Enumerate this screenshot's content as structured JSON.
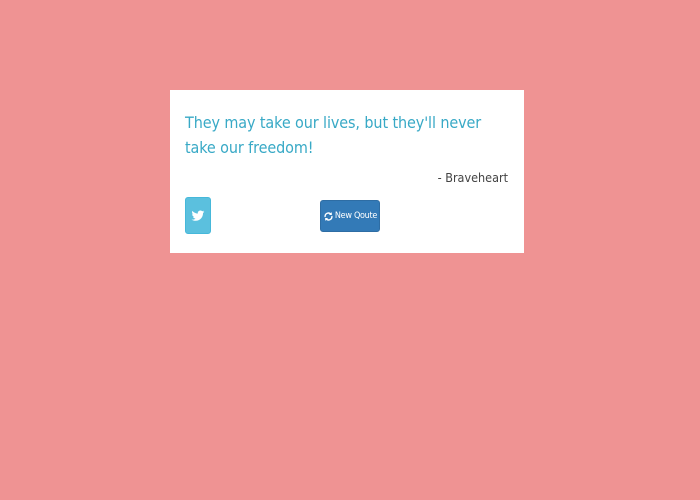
{
  "quote": {
    "text": "They may take our lives, but they'll never take our freedom!",
    "author": "- Braveheart"
  },
  "actions": {
    "tweet_icon": "twitter-icon",
    "new_quote_icon": "refresh-icon",
    "new_quote_label": "New Qoute"
  },
  "colors": {
    "background": "#ef9393",
    "card": "#ffffff",
    "quote_text": "#38a9c6",
    "author_text": "#444444",
    "tweet_button": "#5bc0de",
    "new_quote_button": "#337ab7"
  }
}
